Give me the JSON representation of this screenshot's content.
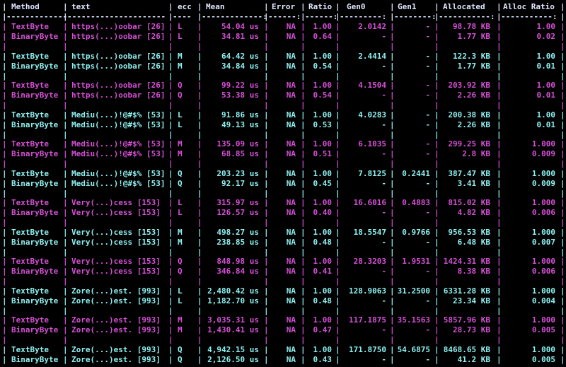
{
  "colors": {
    "background": "#000000",
    "cyan": "#8ef0f0",
    "magenta": "#d64fd6",
    "header": "#dfe8ff"
  },
  "headers": [
    "Method",
    "text",
    "ecc",
    "Mean",
    "Error",
    "Ratio",
    "Gen0",
    "Gen1",
    "Allocated",
    "Alloc Ratio"
  ],
  "separators": [
    "-------------",
    "---------------------",
    "----",
    "-------------:",
    "------:",
    "------:",
    "---------:",
    "--------:",
    "-----------:",
    "-----------:"
  ],
  "groups": [
    {
      "color": "magenta",
      "rows": [
        [
          "TextByte",
          "https(...)oobar [26]",
          "L",
          "54.04 us",
          "NA",
          "1.00",
          "2.0142",
          "-",
          "98.78 KB",
          "1.00"
        ],
        [
          "BinaryByte",
          "https(...)oobar [26]",
          "L",
          "34.81 us",
          "NA",
          "0.64",
          "-",
          "-",
          "1.77 KB",
          "0.02"
        ]
      ]
    },
    {
      "color": "cyan",
      "rows": [
        [
          "TextByte",
          "https(...)oobar [26]",
          "M",
          "64.42 us",
          "NA",
          "1.00",
          "2.4414",
          "-",
          "122.3 KB",
          "1.00"
        ],
        [
          "BinaryByte",
          "https(...)oobar [26]",
          "M",
          "34.84 us",
          "NA",
          "0.54",
          "-",
          "-",
          "1.77 KB",
          "0.01"
        ]
      ]
    },
    {
      "color": "magenta",
      "rows": [
        [
          "TextByte",
          "https(...)oobar [26]",
          "Q",
          "99.22 us",
          "NA",
          "1.00",
          "4.1504",
          "-",
          "203.92 KB",
          "1.00"
        ],
        [
          "BinaryByte",
          "https(...)oobar [26]",
          "Q",
          "53.38 us",
          "NA",
          "0.54",
          "-",
          "-",
          "2.26 KB",
          "0.01"
        ]
      ]
    },
    {
      "color": "cyan",
      "rows": [
        [
          "TextByte",
          "Mediu(...)!@#$% [53]",
          "L",
          "91.86 us",
          "NA",
          "1.00",
          "4.0283",
          "-",
          "200.38 KB",
          "1.00"
        ],
        [
          "BinaryByte",
          "Mediu(...)!@#$% [53]",
          "L",
          "49.13 us",
          "NA",
          "0.53",
          "-",
          "-",
          "2.26 KB",
          "0.01"
        ]
      ]
    },
    {
      "color": "magenta",
      "rows": [
        [
          "TextByte",
          "Mediu(...)!@#$% [53]",
          "M",
          "135.09 us",
          "NA",
          "1.00",
          "6.1035",
          "-",
          "299.25 KB",
          "1.000"
        ],
        [
          "BinaryByte",
          "Mediu(...)!@#$% [53]",
          "M",
          "68.85 us",
          "NA",
          "0.51",
          "-",
          "-",
          "2.8 KB",
          "0.009"
        ]
      ]
    },
    {
      "color": "cyan",
      "rows": [
        [
          "TextByte",
          "Mediu(...)!@#$% [53]",
          "Q",
          "203.23 us",
          "NA",
          "1.00",
          "7.8125",
          "0.2441",
          "387.47 KB",
          "1.000"
        ],
        [
          "BinaryByte",
          "Mediu(...)!@#$% [53]",
          "Q",
          "92.17 us",
          "NA",
          "0.45",
          "-",
          "-",
          "3.41 KB",
          "0.009"
        ]
      ]
    },
    {
      "color": "magenta",
      "rows": [
        [
          "TextByte",
          "Very(...)cess [153]",
          "L",
          "315.97 us",
          "NA",
          "1.00",
          "16.6016",
          "0.4883",
          "815.02 KB",
          "1.000"
        ],
        [
          "BinaryByte",
          "Very(...)cess [153]",
          "L",
          "126.57 us",
          "NA",
          "0.40",
          "-",
          "-",
          "4.82 KB",
          "0.006"
        ]
      ]
    },
    {
      "color": "cyan",
      "rows": [
        [
          "TextByte",
          "Very(...)cess [153]",
          "M",
          "498.27 us",
          "NA",
          "1.00",
          "18.5547",
          "0.9766",
          "956.53 KB",
          "1.000"
        ],
        [
          "BinaryByte",
          "Very(...)cess [153]",
          "M",
          "238.85 us",
          "NA",
          "0.48",
          "-",
          "-",
          "6.48 KB",
          "0.007"
        ]
      ]
    },
    {
      "color": "magenta",
      "rows": [
        [
          "TextByte",
          "Very(...)cess [153]",
          "Q",
          "848.98 us",
          "NA",
          "1.00",
          "28.3203",
          "1.9531",
          "1424.31 KB",
          "1.000"
        ],
        [
          "BinaryByte",
          "Very(...)cess [153]",
          "Q",
          "346.84 us",
          "NA",
          "0.41",
          "-",
          "-",
          "8.38 KB",
          "0.006"
        ]
      ]
    },
    {
      "color": "cyan",
      "rows": [
        [
          "TextByte",
          "Zore(...)est. [993]",
          "L",
          "2,480.42 us",
          "NA",
          "1.00",
          "128.9063",
          "31.2500",
          "6331.28 KB",
          "1.000"
        ],
        [
          "BinaryByte",
          "Zore(...)est. [993]",
          "L",
          "1,182.70 us",
          "NA",
          "0.48",
          "-",
          "-",
          "23.34 KB",
          "0.004"
        ]
      ]
    },
    {
      "color": "magenta",
      "rows": [
        [
          "TextByte",
          "Zore(...)est. [993]",
          "M",
          "3,035.31 us",
          "NA",
          "1.00",
          "117.1875",
          "35.1563",
          "5857.96 KB",
          "1.000"
        ],
        [
          "BinaryByte",
          "Zore(...)est. [993]",
          "M",
          "1,430.41 us",
          "NA",
          "0.47",
          "-",
          "-",
          "28.73 KB",
          "0.005"
        ]
      ]
    },
    {
      "color": "cyan",
      "rows": [
        [
          "TextByte",
          "Zore(...)est. [993]",
          "Q",
          "4,942.15 us",
          "NA",
          "1.00",
          "171.8750",
          "54.6875",
          "8468.65 KB",
          "1.000"
        ],
        [
          "BinaryByte",
          "Zore(...)est. [993]",
          "Q",
          "2,126.50 us",
          "NA",
          "0.43",
          "-",
          "-",
          "41.2 KB",
          "0.005"
        ]
      ]
    }
  ]
}
